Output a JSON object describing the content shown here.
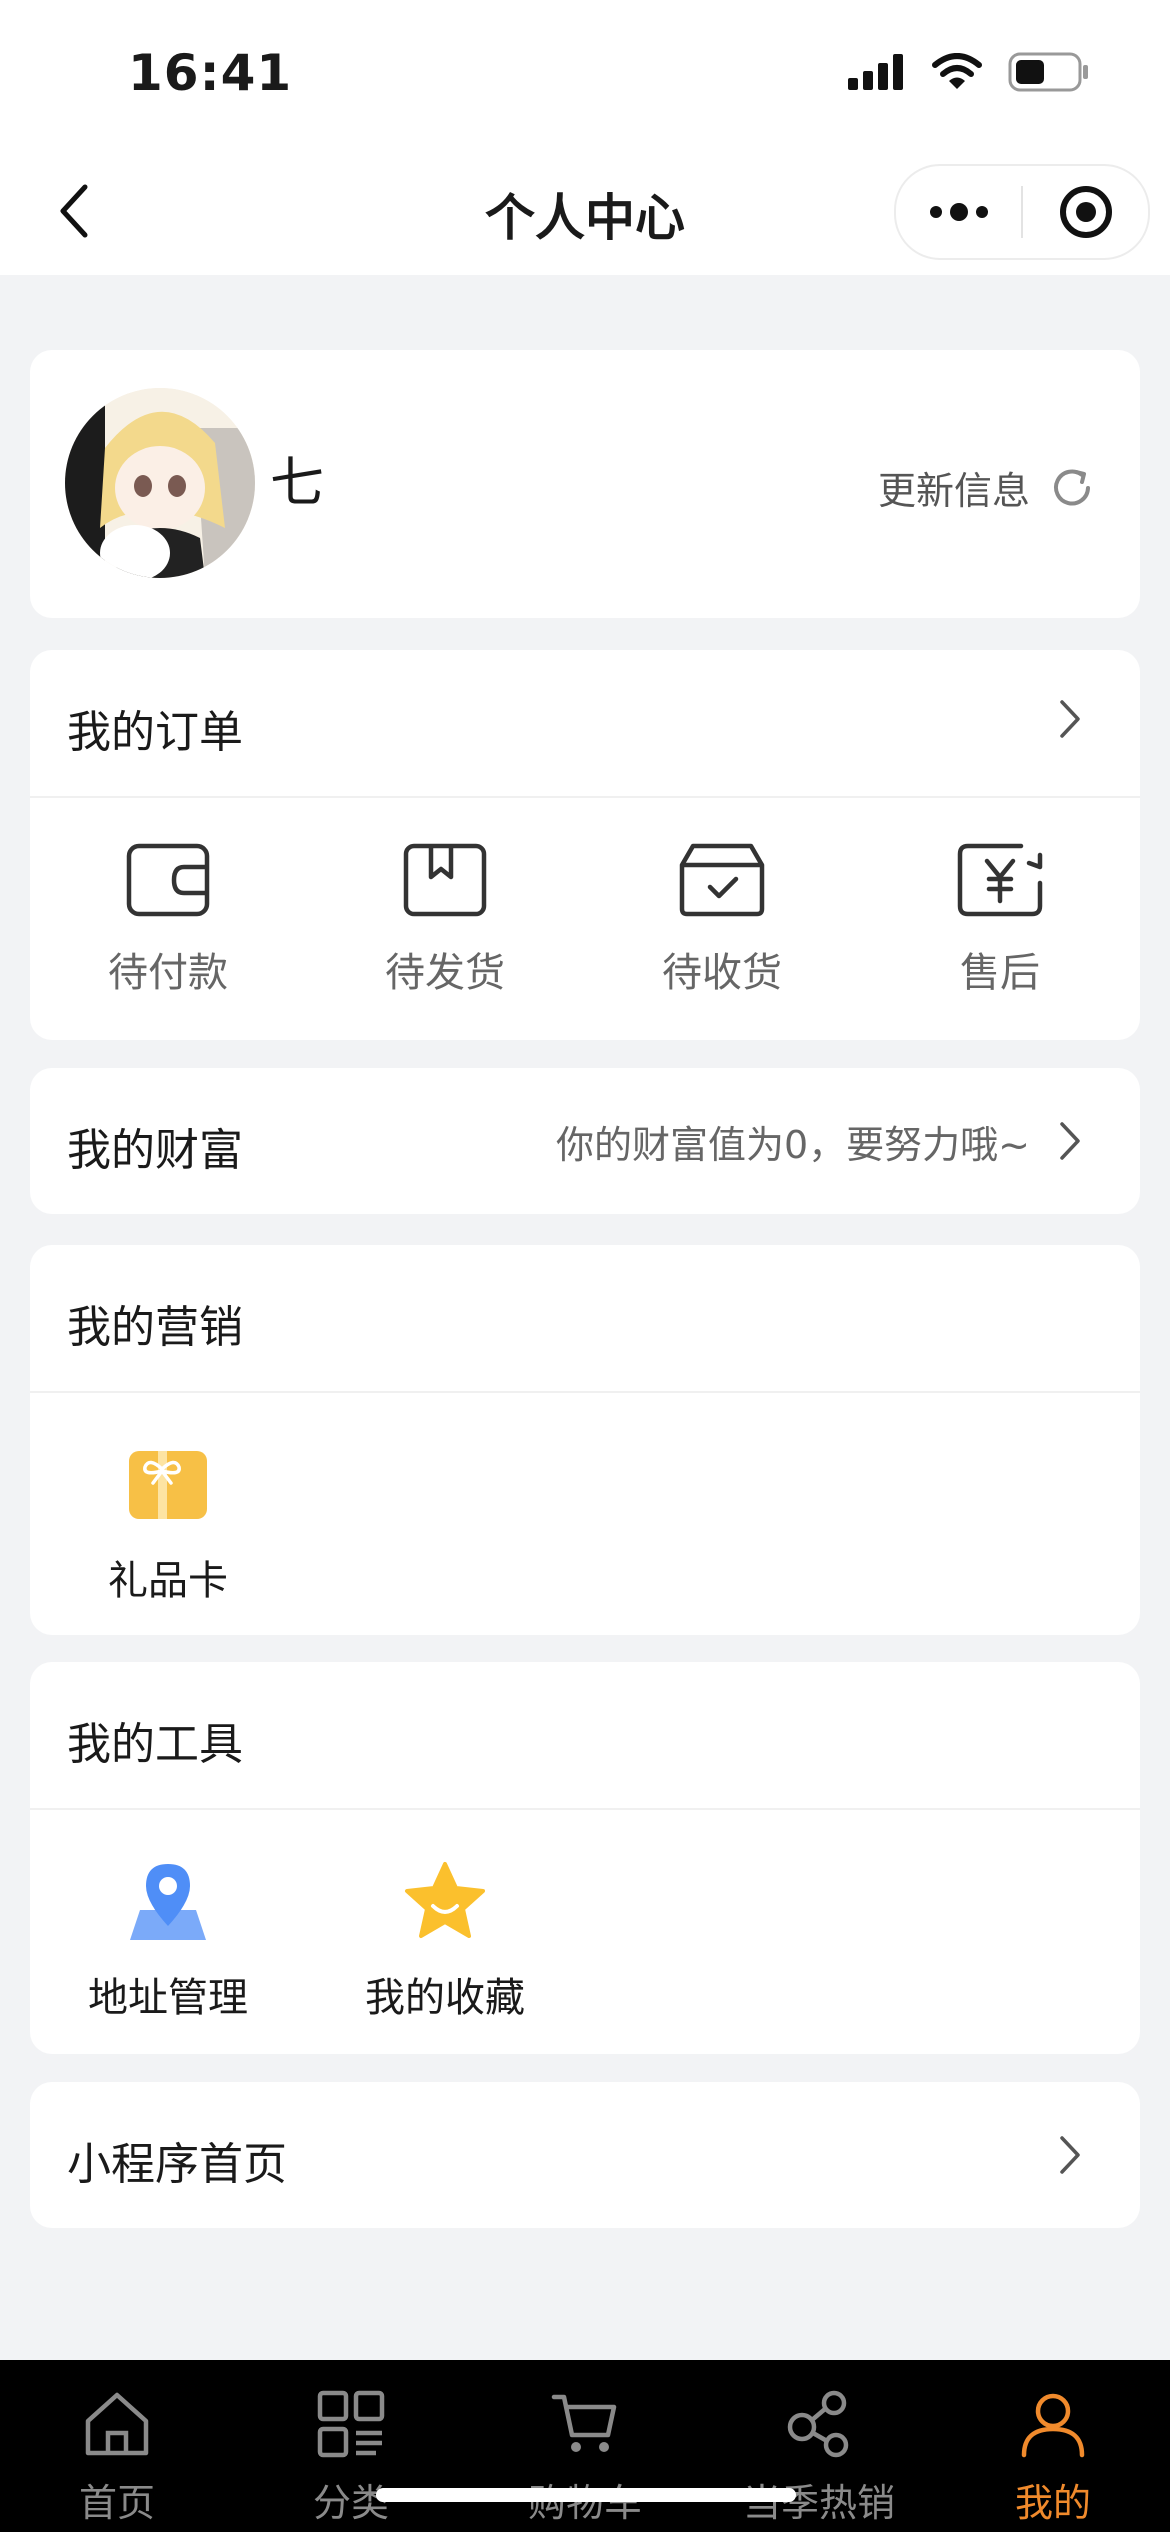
{
  "status_bar": {
    "time": "16:41"
  },
  "nav": {
    "title": "个人中心"
  },
  "profile": {
    "username": "七",
    "refresh_label": "更新信息"
  },
  "orders": {
    "title": "我的订单",
    "items": [
      {
        "label": "待付款",
        "icon": "wallet-icon"
      },
      {
        "label": "待发货",
        "icon": "package-icon"
      },
      {
        "label": "待收货",
        "icon": "box-check-icon"
      },
      {
        "label": "售后",
        "icon": "yen-return-icon"
      }
    ]
  },
  "wealth": {
    "title": "我的财富",
    "hint": "你的财富值为0，要努力哦~"
  },
  "marketing": {
    "title": "我的营销",
    "items": [
      {
        "label": "礼品卡",
        "icon": "gift-card-icon"
      }
    ]
  },
  "tools": {
    "title": "我的工具",
    "items": [
      {
        "label": "地址管理",
        "icon": "location-pin-icon"
      },
      {
        "label": "我的收藏",
        "icon": "star-icon"
      }
    ]
  },
  "miniapp": {
    "title": "小程序首页"
  },
  "tabs": [
    {
      "label": "首页",
      "icon": "home-icon"
    },
    {
      "label": "分类",
      "icon": "category-icon"
    },
    {
      "label": "购物车",
      "icon": "cart-icon"
    },
    {
      "label": "当季热销",
      "icon": "share-nodes-icon"
    },
    {
      "label": "我的",
      "icon": "user-icon",
      "active": true
    }
  ],
  "colors": {
    "accent": "#f08a2c",
    "pin_blue": "#4f8ef7",
    "gift_yellow": "#f7c046",
    "star_yellow": "#fbc02d"
  }
}
